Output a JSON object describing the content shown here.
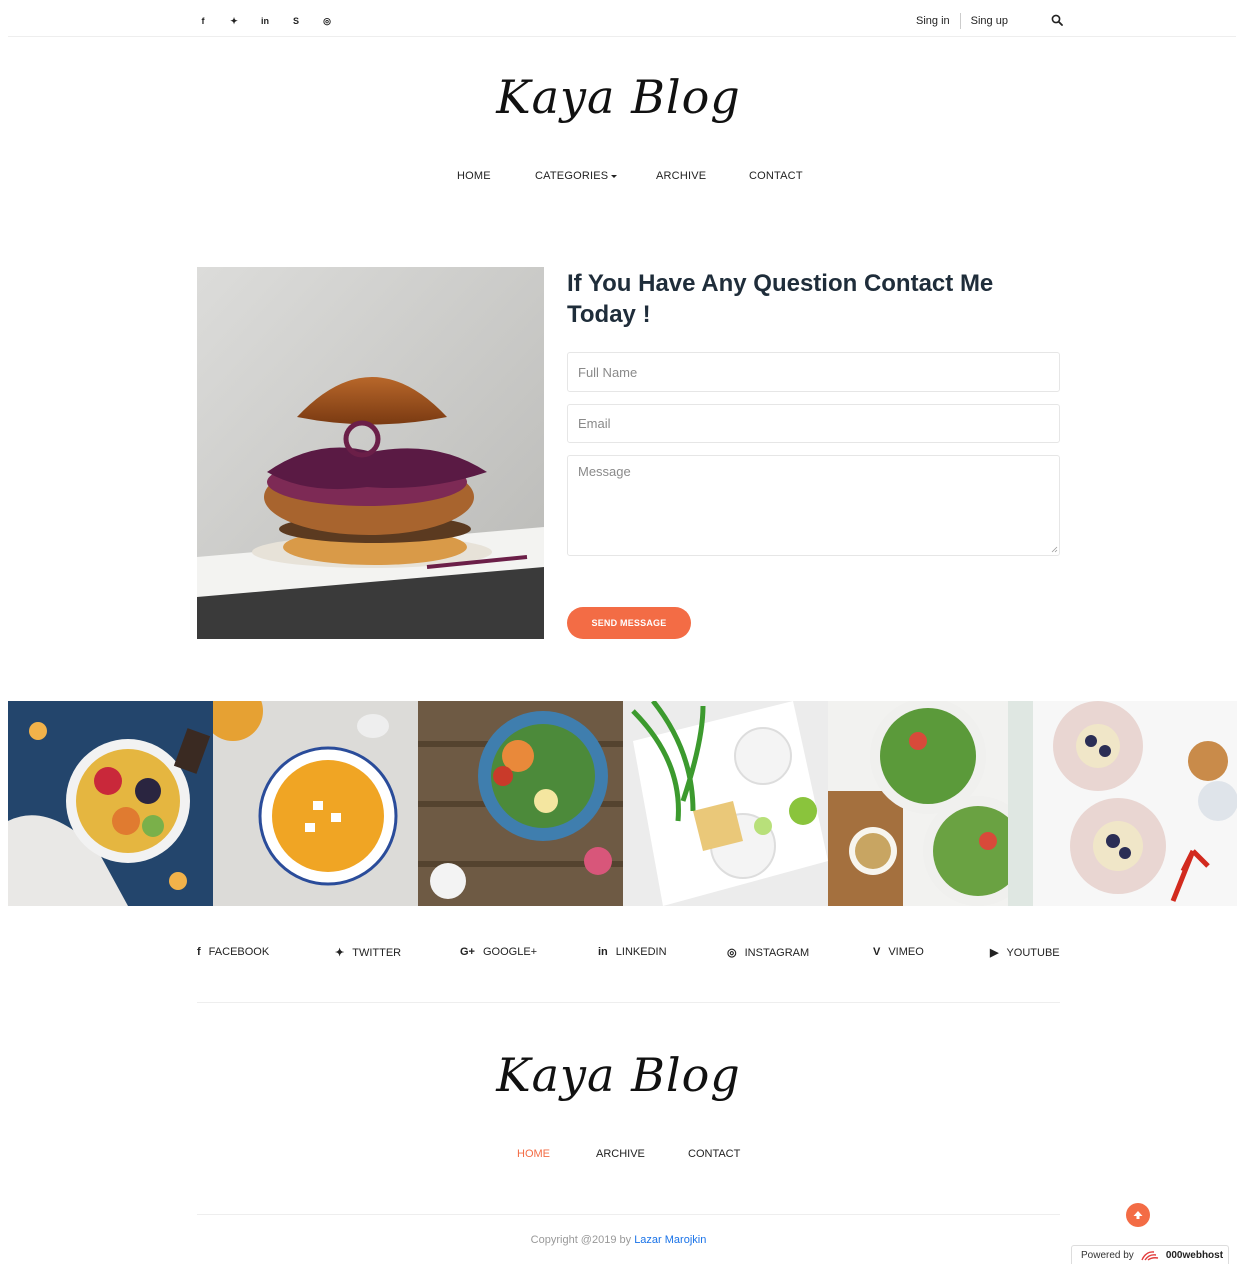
{
  "topbar": {
    "social_icons": [
      {
        "name": "facebook-icon",
        "glyph": "f"
      },
      {
        "name": "twitter-icon",
        "glyph": "✦"
      },
      {
        "name": "linkedin-icon",
        "glyph": "in"
      },
      {
        "name": "skype-icon",
        "glyph": "S"
      },
      {
        "name": "dribbble-icon",
        "glyph": "◎"
      }
    ],
    "sign_in": "Sing in",
    "sign_up": "Sing up"
  },
  "site": {
    "logo": "Kaya Blog"
  },
  "nav": {
    "home": "HOME",
    "categories": "CATEGORIES",
    "archive": "ARCHIVE",
    "contact": "CONTACT"
  },
  "contact_form": {
    "title": "If You Have Any Question Contact Me Today !",
    "name_placeholder": "Full Name",
    "email_placeholder": "Email",
    "message_placeholder": "Message",
    "send_label": "SEND MESSAGE"
  },
  "social_links": [
    {
      "glyph": "f",
      "label": "FACEBOOK"
    },
    {
      "glyph": "✦",
      "label": "TWITTER"
    },
    {
      "glyph": "G+",
      "label": "GOOGLE+"
    },
    {
      "glyph": "in",
      "label": "LINKEDIN"
    },
    {
      "glyph": "◎",
      "label": "INSTAGRAM"
    },
    {
      "glyph": "V",
      "label": "VIMEO"
    },
    {
      "glyph": "▶",
      "label": "YOUTUBE"
    }
  ],
  "footer": {
    "logo": "Kaya Blog",
    "nav": {
      "home": "HOME",
      "archive": "ARCHIVE",
      "contact": "CONTACT"
    },
    "copyright_prefix": "Copyright @2019 by",
    "author": "Lazar Marojkin"
  },
  "powered": {
    "prefix": "Powered by",
    "brand": "000webhost"
  },
  "colors": {
    "accent": "#f36c45",
    "link": "#1a73e8",
    "heading": "#1f2d3a"
  }
}
